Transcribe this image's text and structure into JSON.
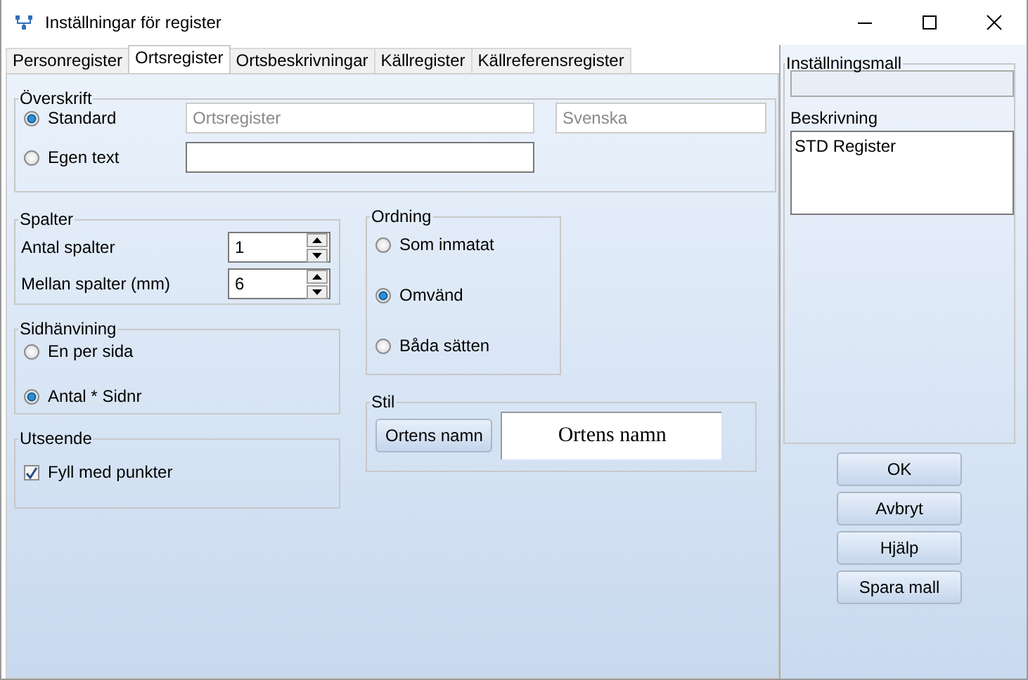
{
  "window": {
    "title": "Inställningar för register"
  },
  "tabs": [
    {
      "label": "Personregister",
      "selected": false
    },
    {
      "label": "Ortsregister",
      "selected": true
    },
    {
      "label": "Ortsbeskrivningar",
      "selected": false
    },
    {
      "label": "Källregister",
      "selected": false
    },
    {
      "label": "Källreferensregister",
      "selected": false
    }
  ],
  "heading": {
    "legend": "Överskrift",
    "options": [
      {
        "label": "Standard",
        "selected": true,
        "value": "Ortsregister",
        "field_disabled": true
      },
      {
        "label": "Egen text",
        "selected": false,
        "field_disabled": false
      }
    ],
    "language": "Svenska"
  },
  "columns": {
    "legend": "Spalter",
    "rows": [
      {
        "label": "Antal spalter",
        "value": "1"
      },
      {
        "label": "Mellan spalter (mm)",
        "value": "6"
      }
    ]
  },
  "page_reference": {
    "legend": "Sidhänvining",
    "options": [
      {
        "label": "En per sida",
        "selected": false
      },
      {
        "label": "Antal * Sidnr",
        "selected": true
      }
    ]
  },
  "appearance": {
    "legend": "Utseende",
    "checkboxes": [
      {
        "label": "Fyll med punkter",
        "checked": true
      }
    ]
  },
  "ordering": {
    "legend": "Ordning",
    "options": [
      {
        "label": "Som inmatat",
        "selected": false
      },
      {
        "label": "Omvänd",
        "selected": true
      },
      {
        "label": "Båda sätten",
        "selected": false
      }
    ]
  },
  "style": {
    "legend": "Stil",
    "button": "Ortens namn",
    "preview": "Ortens namn"
  },
  "template": {
    "legend": "Inställningsmall",
    "description_label": "Beskrivning",
    "description": "STD Register"
  },
  "buttons": [
    "OK",
    "Avbryt",
    "Hjälp",
    "Spara mall"
  ]
}
